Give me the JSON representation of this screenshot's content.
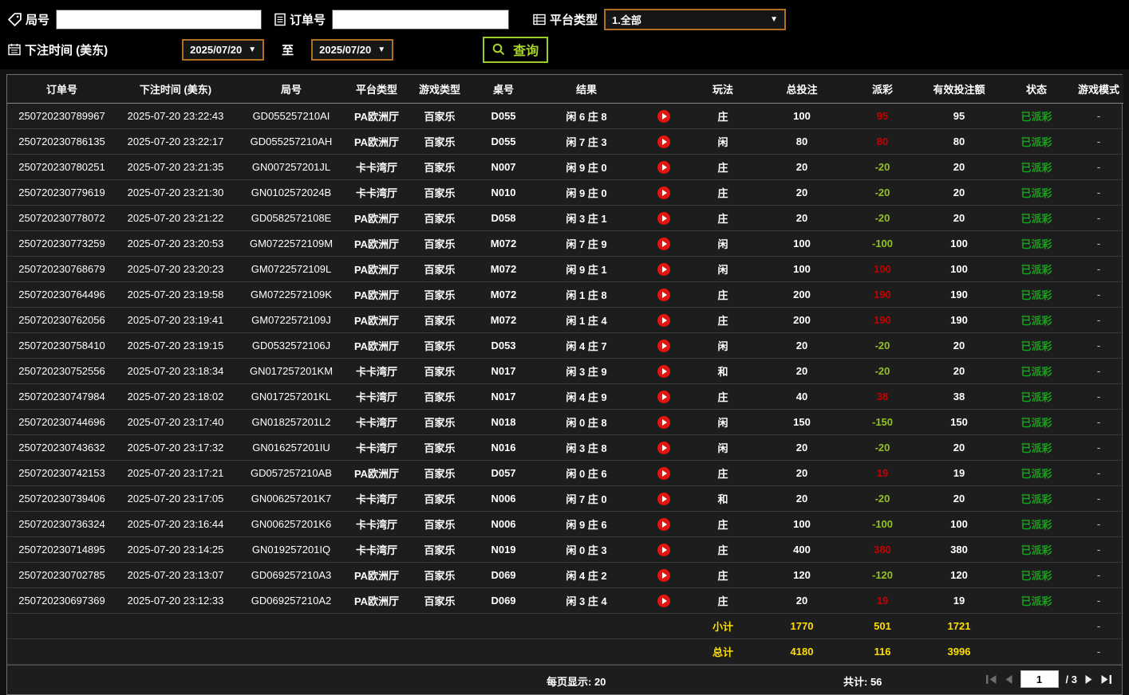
{
  "filters": {
    "game_no_label": "局号",
    "game_no_value": "",
    "order_no_label": "订单号",
    "order_no_value": "",
    "platform_label": "平台类型",
    "platform_value": "1.全部",
    "bet_time_label": "下注时间 (美东)",
    "date_from": "2025/07/20",
    "to_label": "至",
    "date_to": "2025/07/20",
    "search_label": "查询"
  },
  "table": {
    "headers": [
      "订单号",
      "下注时间 (美东)",
      "局号",
      "平台类型",
      "游戏类型",
      "桌号",
      "结果",
      "",
      "玩法",
      "总投注",
      "派彩",
      "有效投注额",
      "状态",
      "游戏模式"
    ],
    "rows": [
      {
        "order_no": "250720230789967",
        "bet_time": "2025-07-20 23:22:43",
        "game_no": "GD055257210AI",
        "platform": "PA欧洲厅",
        "game_type": "百家乐",
        "table_no": "D055",
        "result": "闲 6 庄 8",
        "play_style": "庄",
        "total_bet": "100",
        "payout": "95",
        "valid_bet": "95",
        "status": "已派彩",
        "mode": "-"
      },
      {
        "order_no": "250720230786135",
        "bet_time": "2025-07-20 23:22:17",
        "game_no": "GD055257210AH",
        "platform": "PA欧洲厅",
        "game_type": "百家乐",
        "table_no": "D055",
        "result": "闲 7 庄 3",
        "play_style": "闲",
        "total_bet": "80",
        "payout": "80",
        "valid_bet": "80",
        "status": "已派彩",
        "mode": "-"
      },
      {
        "order_no": "250720230780251",
        "bet_time": "2025-07-20 23:21:35",
        "game_no": "GN007257201JL",
        "platform": "卡卡湾厅",
        "game_type": "百家乐",
        "table_no": "N007",
        "result": "闲 9 庄 0",
        "play_style": "庄",
        "total_bet": "20",
        "payout": "-20",
        "valid_bet": "20",
        "status": "已派彩",
        "mode": "-"
      },
      {
        "order_no": "250720230779619",
        "bet_time": "2025-07-20 23:21:30",
        "game_no": "GN0102572024B",
        "platform": "卡卡湾厅",
        "game_type": "百家乐",
        "table_no": "N010",
        "result": "闲 9 庄 0",
        "play_style": "庄",
        "total_bet": "20",
        "payout": "-20",
        "valid_bet": "20",
        "status": "已派彩",
        "mode": "-"
      },
      {
        "order_no": "250720230778072",
        "bet_time": "2025-07-20 23:21:22",
        "game_no": "GD0582572108E",
        "platform": "PA欧洲厅",
        "game_type": "百家乐",
        "table_no": "D058",
        "result": "闲 3 庄 1",
        "play_style": "庄",
        "total_bet": "20",
        "payout": "-20",
        "valid_bet": "20",
        "status": "已派彩",
        "mode": "-"
      },
      {
        "order_no": "250720230773259",
        "bet_time": "2025-07-20 23:20:53",
        "game_no": "GM0722572109M",
        "platform": "PA欧洲厅",
        "game_type": "百家乐",
        "table_no": "M072",
        "result": "闲 7 庄 9",
        "play_style": "闲",
        "total_bet": "100",
        "payout": "-100",
        "valid_bet": "100",
        "status": "已派彩",
        "mode": "-"
      },
      {
        "order_no": "250720230768679",
        "bet_time": "2025-07-20 23:20:23",
        "game_no": "GM0722572109L",
        "platform": "PA欧洲厅",
        "game_type": "百家乐",
        "table_no": "M072",
        "result": "闲 9 庄 1",
        "play_style": "闲",
        "total_bet": "100",
        "payout": "100",
        "valid_bet": "100",
        "status": "已派彩",
        "mode": "-"
      },
      {
        "order_no": "250720230764496",
        "bet_time": "2025-07-20 23:19:58",
        "game_no": "GM0722572109K",
        "platform": "PA欧洲厅",
        "game_type": "百家乐",
        "table_no": "M072",
        "result": "闲 1 庄 8",
        "play_style": "庄",
        "total_bet": "200",
        "payout": "190",
        "valid_bet": "190",
        "status": "已派彩",
        "mode": "-"
      },
      {
        "order_no": "250720230762056",
        "bet_time": "2025-07-20 23:19:41",
        "game_no": "GM0722572109J",
        "platform": "PA欧洲厅",
        "game_type": "百家乐",
        "table_no": "M072",
        "result": "闲 1 庄 4",
        "play_style": "庄",
        "total_bet": "200",
        "payout": "190",
        "valid_bet": "190",
        "status": "已派彩",
        "mode": "-"
      },
      {
        "order_no": "250720230758410",
        "bet_time": "2025-07-20 23:19:15",
        "game_no": "GD0532572106J",
        "platform": "PA欧洲厅",
        "game_type": "百家乐",
        "table_no": "D053",
        "result": "闲 4 庄 7",
        "play_style": "闲",
        "total_bet": "20",
        "payout": "-20",
        "valid_bet": "20",
        "status": "已派彩",
        "mode": "-"
      },
      {
        "order_no": "250720230752556",
        "bet_time": "2025-07-20 23:18:34",
        "game_no": "GN017257201KM",
        "platform": "卡卡湾厅",
        "game_type": "百家乐",
        "table_no": "N017",
        "result": "闲 3 庄 9",
        "play_style": "和",
        "total_bet": "20",
        "payout": "-20",
        "valid_bet": "20",
        "status": "已派彩",
        "mode": "-"
      },
      {
        "order_no": "250720230747984",
        "bet_time": "2025-07-20 23:18:02",
        "game_no": "GN017257201KL",
        "platform": "卡卡湾厅",
        "game_type": "百家乐",
        "table_no": "N017",
        "result": "闲 4 庄 9",
        "play_style": "庄",
        "total_bet": "40",
        "payout": "38",
        "valid_bet": "38",
        "status": "已派彩",
        "mode": "-"
      },
      {
        "order_no": "250720230744696",
        "bet_time": "2025-07-20 23:17:40",
        "game_no": "GN018257201L2",
        "platform": "卡卡湾厅",
        "game_type": "百家乐",
        "table_no": "N018",
        "result": "闲 0 庄 8",
        "play_style": "闲",
        "total_bet": "150",
        "payout": "-150",
        "valid_bet": "150",
        "status": "已派彩",
        "mode": "-"
      },
      {
        "order_no": "250720230743632",
        "bet_time": "2025-07-20 23:17:32",
        "game_no": "GN016257201IU",
        "platform": "卡卡湾厅",
        "game_type": "百家乐",
        "table_no": "N016",
        "result": "闲 3 庄 8",
        "play_style": "闲",
        "total_bet": "20",
        "payout": "-20",
        "valid_bet": "20",
        "status": "已派彩",
        "mode": "-"
      },
      {
        "order_no": "250720230742153",
        "bet_time": "2025-07-20 23:17:21",
        "game_no": "GD057257210AB",
        "platform": "PA欧洲厅",
        "game_type": "百家乐",
        "table_no": "D057",
        "result": "闲 0 庄 6",
        "play_style": "庄",
        "total_bet": "20",
        "payout": "19",
        "valid_bet": "19",
        "status": "已派彩",
        "mode": "-"
      },
      {
        "order_no": "250720230739406",
        "bet_time": "2025-07-20 23:17:05",
        "game_no": "GN006257201K7",
        "platform": "卡卡湾厅",
        "game_type": "百家乐",
        "table_no": "N006",
        "result": "闲 7 庄 0",
        "play_style": "和",
        "total_bet": "20",
        "payout": "-20",
        "valid_bet": "20",
        "status": "已派彩",
        "mode": "-"
      },
      {
        "order_no": "250720230736324",
        "bet_time": "2025-07-20 23:16:44",
        "game_no": "GN006257201K6",
        "platform": "卡卡湾厅",
        "game_type": "百家乐",
        "table_no": "N006",
        "result": "闲 9 庄 6",
        "play_style": "庄",
        "total_bet": "100",
        "payout": "-100",
        "valid_bet": "100",
        "status": "已派彩",
        "mode": "-"
      },
      {
        "order_no": "250720230714895",
        "bet_time": "2025-07-20 23:14:25",
        "game_no": "GN019257201IQ",
        "platform": "卡卡湾厅",
        "game_type": "百家乐",
        "table_no": "N019",
        "result": "闲 0 庄 3",
        "play_style": "庄",
        "total_bet": "400",
        "payout": "380",
        "valid_bet": "380",
        "status": "已派彩",
        "mode": "-"
      },
      {
        "order_no": "250720230702785",
        "bet_time": "2025-07-20 23:13:07",
        "game_no": "GD069257210A3",
        "platform": "PA欧洲厅",
        "game_type": "百家乐",
        "table_no": "D069",
        "result": "闲 4 庄 2",
        "play_style": "庄",
        "total_bet": "120",
        "payout": "-120",
        "valid_bet": "120",
        "status": "已派彩",
        "mode": "-"
      },
      {
        "order_no": "250720230697369",
        "bet_time": "2025-07-20 23:12:33",
        "game_no": "GD069257210A2",
        "platform": "PA欧洲厅",
        "game_type": "百家乐",
        "table_no": "D069",
        "result": "闲 3 庄 4",
        "play_style": "庄",
        "total_bet": "20",
        "payout": "19",
        "valid_bet": "19",
        "status": "已派彩",
        "mode": "-"
      }
    ]
  },
  "summary": {
    "subtotal_label": "小计",
    "subtotal_total_bet": "1770",
    "subtotal_payout": "501",
    "subtotal_valid_bet": "1721",
    "subtotal_mode": "-",
    "total_label": "总计",
    "total_total_bet": "4180",
    "total_payout": "116",
    "total_valid_bet": "3996",
    "total_mode": "-"
  },
  "pagination": {
    "per_page_label": "每页显示: 20",
    "total_count_label": "共计: 56",
    "current_page": "1",
    "page_total": "/ 3"
  }
}
